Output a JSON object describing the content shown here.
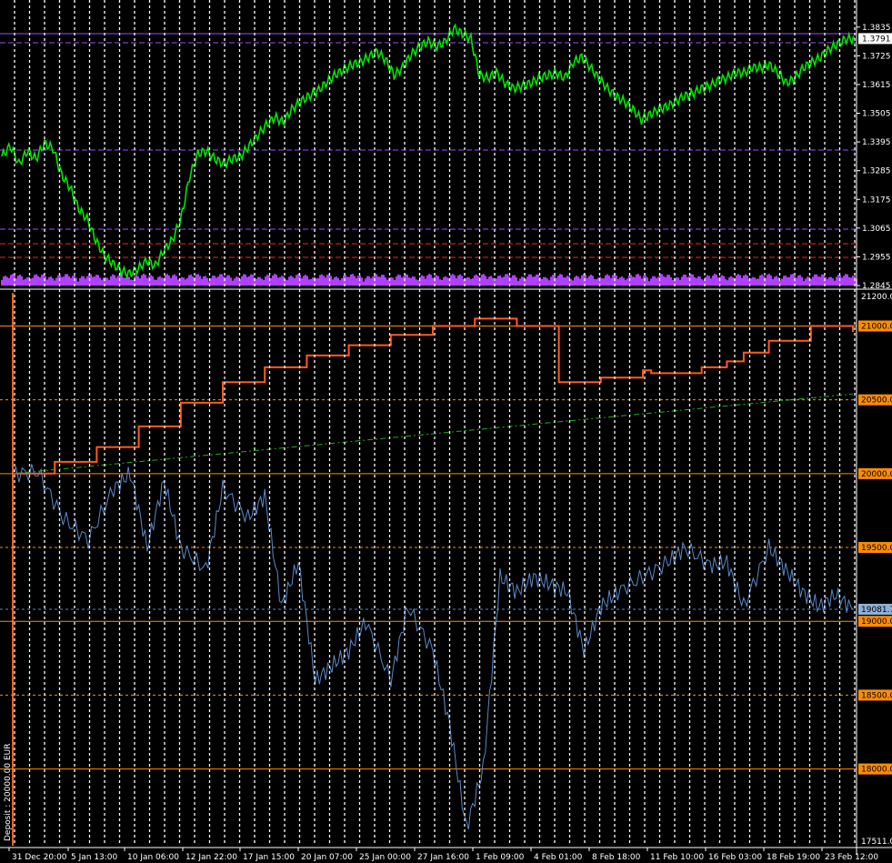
{
  "chart_data": [
    {
      "type": "line",
      "panel": "price",
      "series": [
        {
          "color": "#00e600",
          "x": [
            0,
            1,
            2,
            3,
            4,
            5,
            6,
            7,
            8,
            9,
            10,
            11,
            12,
            13,
            14,
            15,
            16,
            17,
            18,
            19,
            20,
            21,
            22,
            23,
            24,
            25,
            26,
            27,
            28,
            29,
            30,
            31,
            32,
            33,
            34,
            35,
            36,
            37,
            38,
            39,
            40,
            41,
            42,
            43,
            44,
            45,
            46,
            47,
            48,
            49,
            50,
            51,
            52,
            53,
            54,
            55,
            56,
            57,
            58,
            59,
            60,
            61,
            62,
            63,
            64,
            65,
            66,
            67,
            68,
            69,
            70,
            71,
            72,
            73,
            74,
            75,
            76,
            77,
            78,
            79,
            80,
            81,
            82,
            83,
            84,
            85,
            86,
            87,
            88,
            89,
            90,
            91,
            92,
            93,
            94,
            95,
            96,
            97,
            98,
            99,
            100
          ],
          "values": [
            1.334,
            1.338,
            1.331,
            1.336,
            1.333,
            1.339,
            1.337,
            1.327,
            1.322,
            1.314,
            1.31,
            1.302,
            1.296,
            1.293,
            1.29,
            1.289,
            1.291,
            1.294,
            1.292,
            1.298,
            1.302,
            1.31,
            1.326,
            1.335,
            1.336,
            1.333,
            1.331,
            1.333,
            1.334,
            1.338,
            1.342,
            1.346,
            1.349,
            1.347,
            1.352,
            1.355,
            1.357,
            1.359,
            1.362,
            1.365,
            1.367,
            1.369,
            1.37,
            1.372,
            1.374,
            1.371,
            1.365,
            1.368,
            1.373,
            1.376,
            1.378,
            1.376,
            1.378,
            1.383,
            1.381,
            1.379,
            1.365,
            1.364,
            1.366,
            1.362,
            1.36,
            1.361,
            1.362,
            1.364,
            1.365,
            1.366,
            1.364,
            1.37,
            1.372,
            1.368,
            1.364,
            1.36,
            1.357,
            1.355,
            1.352,
            1.348,
            1.35,
            1.352,
            1.353,
            1.355,
            1.357,
            1.358,
            1.36,
            1.361,
            1.363,
            1.364,
            1.366,
            1.366,
            1.368,
            1.368,
            1.369,
            1.366,
            1.362,
            1.364,
            1.368,
            1.37,
            1.372,
            1.375,
            1.377,
            1.379,
            1.379
          ]
        }
      ],
      "ylim": [
        1.2845,
        1.389
      ],
      "y_ticks": [
        "1.3835",
        "1.3725",
        "1.3615",
        "1.3505",
        "1.3395",
        "1.3285",
        "1.3175",
        "1.3065",
        "1.2955",
        "1.2845"
      ],
      "current_value": "1.3791",
      "colors": {
        "price": "#00e600",
        "volume": "#b040ff",
        "level_violet": "#9a4cff",
        "level_red": "#ff2020"
      }
    },
    {
      "type": "line",
      "panel": "balance_equity",
      "series": [
        {
          "color": "#ff5a1f",
          "x": [
            0,
            5,
            10,
            15,
            20,
            25,
            30,
            35,
            40,
            45,
            50,
            55,
            60,
            65,
            70,
            75,
            76,
            80,
            82,
            85,
            87,
            90,
            95,
            100
          ],
          "values": [
            20000,
            20080,
            20180,
            20320,
            20480,
            20620,
            20720,
            20800,
            20870,
            20940,
            21000,
            21050,
            21000,
            20620,
            20650,
            20700,
            20680,
            20680,
            20720,
            20760,
            20820,
            20900,
            21000,
            20960
          ]
        },
        {
          "color": "#5a8ac8",
          "x": [
            0,
            3,
            6,
            9,
            12,
            14,
            16,
            18,
            20,
            23,
            25,
            28,
            30,
            32,
            34,
            36,
            38,
            40,
            42,
            45,
            47,
            50,
            52,
            54,
            56,
            58,
            60,
            62,
            64,
            66,
            68,
            70,
            72,
            75,
            78,
            80,
            83,
            85,
            87,
            90,
            92,
            94,
            96,
            98,
            100
          ],
          "values": [
            20000,
            20010,
            19700,
            19550,
            19900,
            20000,
            19500,
            19950,
            19500,
            19350,
            19900,
            19700,
            19850,
            19100,
            19400,
            18600,
            18700,
            18800,
            19000,
            18600,
            19100,
            18800,
            18300,
            17600,
            18000,
            19300,
            19200,
            19300,
            19250,
            19200,
            18800,
            19100,
            19200,
            19300,
            19400,
            19500,
            19380,
            19400,
            19100,
            19500,
            19350,
            19200,
            19100,
            19180,
            19081
          ]
        },
        {
          "color": "#1fae1f",
          "x": [
            0,
            100
          ],
          "values": [
            20000,
            20540
          ]
        }
      ],
      "ylim": [
        17511,
        21200
      ],
      "y_ticks": [
        "21200.0",
        "21000.0",
        "20500.0",
        "20000.0",
        "19500.0",
        "19081.7",
        "19000.0",
        "18500.0",
        "18000.0",
        "17511.0"
      ],
      "current_value": "19081.7",
      "colors": {
        "balance": "#ff5a1f",
        "equity": "#5a8ac8",
        "trend": "#1fae1f",
        "levels": "#ff8c00"
      }
    }
  ],
  "x_axis": {
    "labels": [
      "31 Dec 20:00",
      "5 Jan 13:00",
      "10 Jan 06:00",
      "12 Jan 22:00",
      "17 Jan 15:00",
      "20 Jan 07:00",
      "25 Jan 00:00",
      "27 Jan 16:00",
      "1 Feb 09:00",
      "4 Feb 01:00",
      "8 Feb 18:00",
      "11 Feb 10:00",
      "16 Feb 03:00",
      "18 Feb 19:00",
      "23 Feb 12:00"
    ]
  },
  "deposit_label": "Deposit : 20000.00 EUR"
}
